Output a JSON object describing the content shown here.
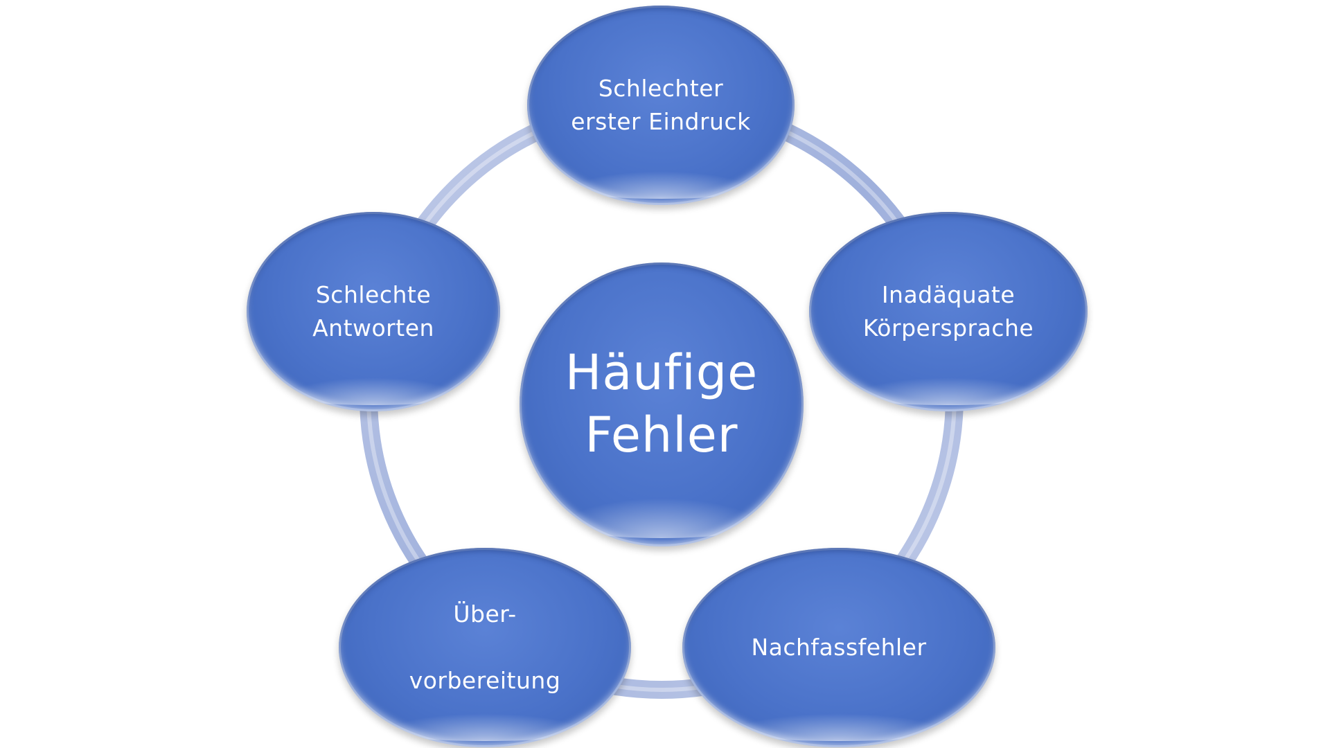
{
  "diagram": {
    "center": {
      "label": "Häufige\nFehler"
    },
    "nodes": [
      {
        "id": "top",
        "label": "Schlechter\nerster Eindruck"
      },
      {
        "id": "right",
        "label": "Inadäquate\nKörpersprache"
      },
      {
        "id": "bottom-right",
        "label": "Nachfassfehler"
      },
      {
        "id": "bottom-left",
        "label": "Über-\n\nvorbereitung"
      },
      {
        "id": "left",
        "label": "Schlechte\nAntworten"
      }
    ],
    "colors": {
      "node_fill": "#4a72c9",
      "ring": "#a9b7dc",
      "text": "#ffffff"
    }
  }
}
